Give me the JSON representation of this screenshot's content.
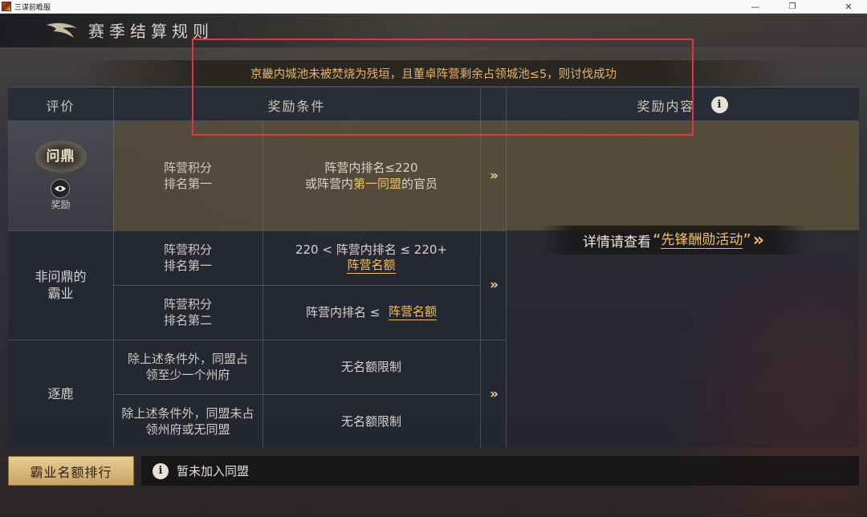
{
  "window": {
    "title": "三谋前瞻服",
    "minimize_glyph": "—",
    "maximize_glyph": "❐",
    "close_glyph": "✕"
  },
  "page": {
    "title": "赛季结算规则",
    "banner": "京畿内城池未被焚烧为残垣，且董卓阵营剩余占领城池≤5，则讨伐成功"
  },
  "table": {
    "headers": {
      "rating": "评价",
      "condition": "奖励条件",
      "reward": "奖励内容"
    },
    "rows": {
      "wending": {
        "rank_label": "问鼎",
        "reward_tag": "奖励",
        "c1": "阵营积分\n排名第一",
        "c2_line1": "阵营内排名≤220",
        "c2_prefix": "或阵营内",
        "c2_gold": "第一同盟",
        "c2_suffix": "的官员"
      },
      "baye_label": "非问鼎的\n霸业",
      "baye_1": {
        "c1": "阵营积分\n排名第一",
        "c2_line1": "220 < 阵营内排名 ≤ 220+",
        "c2_link": "阵营名额"
      },
      "baye_2": {
        "c1": "阵营积分\n排名第二",
        "c2_text": "阵营内排名 ≤ ",
        "c2_link": "阵营名额"
      },
      "zhulu_label": "逐鹿",
      "zhulu_1": {
        "c1": "除上述条件外，同盟占\n领至少一个州府",
        "c2": "无名额限制"
      },
      "zhulu_2": {
        "c1": "除上述条件外，同盟未占\n领州府或无同盟",
        "c2": "无名额限制"
      },
      "arrow_glyph": "»"
    },
    "reward_detail": {
      "prefix": "详情请查看",
      "open_quote": "“",
      "link": "先锋酬勋活动",
      "close_quote": "”",
      "chevrons": "»"
    }
  },
  "footer": {
    "rank_button": "霸业名额排行",
    "info_glyph": "i",
    "alliance_status": "暂未加入同盟"
  },
  "colors": {
    "accent_gold": "#f0c060",
    "banner_text": "#e9b26a",
    "highlight_box": "#e8343c"
  }
}
